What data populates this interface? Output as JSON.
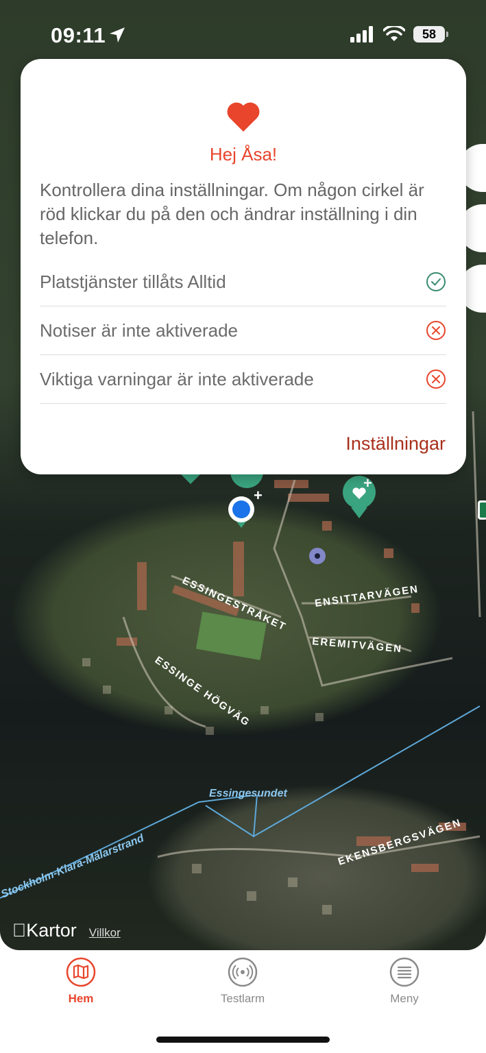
{
  "status": {
    "time": "09:11",
    "battery": "58"
  },
  "dialog": {
    "greeting": "Hej Åsa!",
    "intro": "Kontrollera dina inställningar. Om någon cirkel är röd klickar du på den och ändrar inställning i din telefon.",
    "items": [
      {
        "label": "Platstjänster tillåts Alltid",
        "state": "ok"
      },
      {
        "label": "Notiser är inte aktiverade",
        "state": "error"
      },
      {
        "label": "Viktiga varningar är inte aktiverade",
        "state": "error"
      }
    ],
    "settings_link": "Inställningar"
  },
  "map": {
    "labels": {
      "essingestraket": "ESSINGESTRÅKET",
      "ensittarvagen": "ENSITTARVÄGEN",
      "eremitvagen": "EREMITVÄGEN",
      "essinge_hogvag": "ESSINGE HÖGVÄG",
      "essingesundet": "Essingesundet",
      "stockholm_klara": "Stockholm-Klara-Mälarstrand",
      "ekensbergsvagen": "EKENSBERGSVÄGEN"
    },
    "attribution_brand": "Kartor",
    "attribution_terms": "Villkor"
  },
  "tabs": [
    {
      "label": "Hem",
      "icon": "map-icon",
      "active": true
    },
    {
      "label": "Testlarm",
      "icon": "broadcast-icon",
      "active": false
    },
    {
      "label": "Meny",
      "icon": "menu-icon",
      "active": false
    }
  ],
  "colors": {
    "accent": "#e8452c",
    "ok": "#3a8a72",
    "error": "#e8452c",
    "inactive": "#8a8a8a",
    "link": "#a8301c",
    "pin": "#3aa37f"
  }
}
